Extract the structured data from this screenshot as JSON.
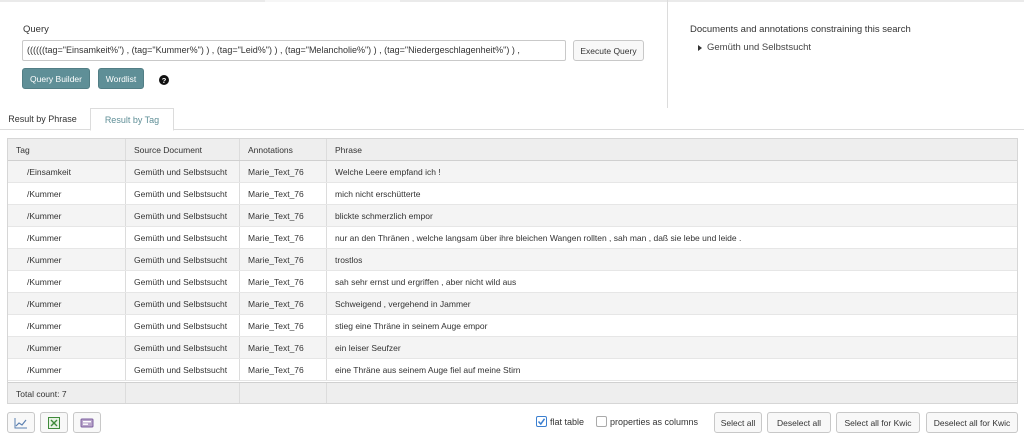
{
  "query": {
    "label": "Query",
    "value": "((((((tag=\"Einsamkeit%\") , (tag=\"Kummer%\") ) , (tag=\"Leid%\") ) , (tag=\"Melancholie%\") ) , (tag=\"Niedergeschlagenheit%\") ) ,",
    "execute_label": "Execute Query",
    "query_builder_label": "Query Builder",
    "wordlist_label": "Wordlist",
    "help_icon": "?"
  },
  "constraints": {
    "label": "Documents and annotations constraining this search",
    "items": [
      {
        "label": "Gemüth und Selbstsucht",
        "icon": "triangle-right-icon"
      }
    ]
  },
  "tabs": [
    {
      "label": "Result by Phrase",
      "active": false
    },
    {
      "label": "Result by Tag",
      "active": true
    }
  ],
  "table": {
    "columns": [
      "Tag",
      "Source Document",
      "Annotations",
      "Phrase"
    ],
    "rows": [
      [
        "/Einsamkeit",
        "Gemüth und Selbstsucht",
        "Marie_Text_76",
        "Welche Leere empfand ich !"
      ],
      [
        "/Kummer",
        "Gemüth und Selbstsucht",
        "Marie_Text_76",
        "mich nicht erschütterte"
      ],
      [
        "/Kummer",
        "Gemüth und Selbstsucht",
        "Marie_Text_76",
        "blickte schmerzlich empor"
      ],
      [
        "/Kummer",
        "Gemüth und Selbstsucht",
        "Marie_Text_76",
        "nur an den Thränen , welche langsam über ihre bleichen Wangen rollten , sah man , daß sie lebe und leide ."
      ],
      [
        "/Kummer",
        "Gemüth und Selbstsucht",
        "Marie_Text_76",
        "trostlos"
      ],
      [
        "/Kummer",
        "Gemüth und Selbstsucht",
        "Marie_Text_76",
        "sah sehr ernst und ergriffen , aber nicht wild aus"
      ],
      [
        "/Kummer",
        "Gemüth und Selbstsucht",
        "Marie_Text_76",
        "Schweigend , vergehend in Jammer"
      ],
      [
        "/Kummer",
        "Gemüth und Selbstsucht",
        "Marie_Text_76",
        "stieg eine Thräne in seinem Auge empor"
      ],
      [
        "/Kummer",
        "Gemüth und Selbstsucht",
        "Marie_Text_76",
        "ein leiser Seufzer"
      ],
      [
        "/Kummer",
        "Gemüth und Selbstsucht",
        "Marie_Text_76",
        "eine Thräne aus seinem Auge fiel auf meine Stirn"
      ]
    ],
    "footer": "Total count: 7"
  },
  "bottom": {
    "icons": [
      "chart-icon",
      "excel-export-icon",
      "kwic-export-icon"
    ],
    "flat_table_label": "flat table",
    "flat_table_checked": true,
    "properties_label": "properties as columns",
    "properties_checked": false,
    "select_all_label": "Select all",
    "deselect_all_label": "Deselect all",
    "select_all_kwic_label": "Select all for Kwic",
    "deselect_all_kwic_label": "Deselect all for Kwic"
  },
  "colors": {
    "accent": "#5f8f97",
    "checkbox": "#3b7fd0"
  }
}
